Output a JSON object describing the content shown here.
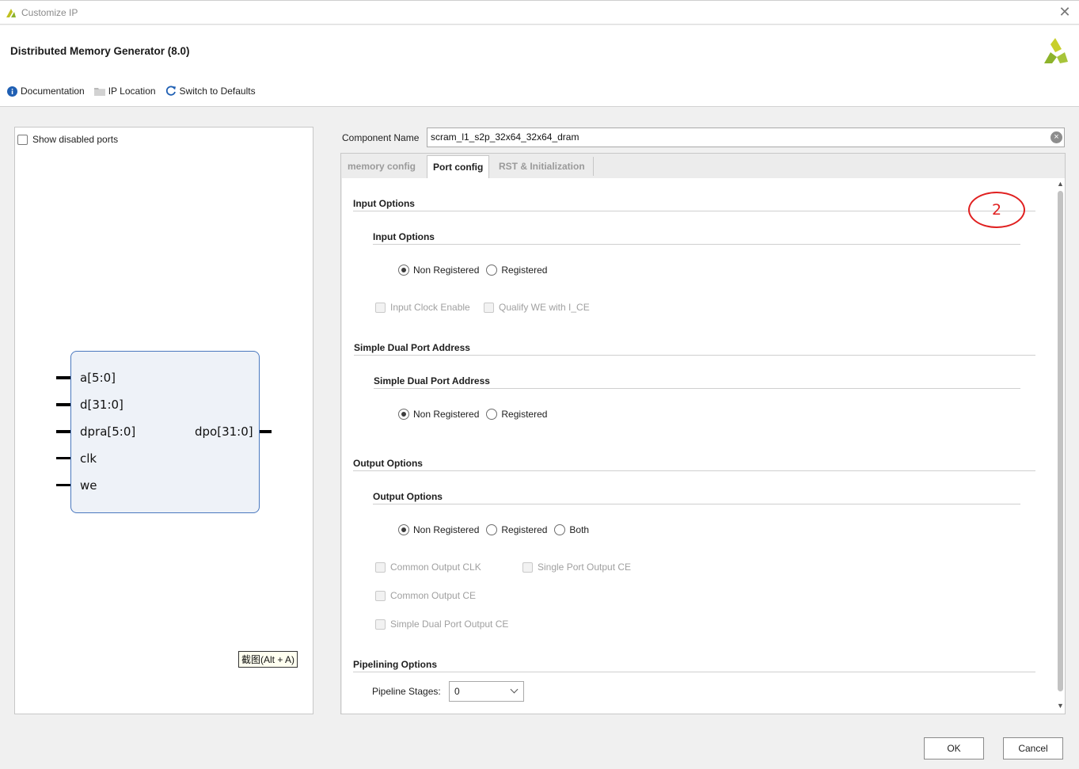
{
  "window": {
    "title": "Customize IP",
    "close_glyph": "✕"
  },
  "header": {
    "product_title": "Distributed Memory Generator (8.0)",
    "toolbar": {
      "documentation": "Documentation",
      "ip_location": "IP Location",
      "switch_defaults": "Switch to Defaults"
    }
  },
  "left_panel": {
    "show_disabled_ports": "Show disabled ports",
    "block": {
      "inputs": [
        "a[5:0]",
        "d[31:0]",
        "dpra[5:0]",
        "clk",
        "we"
      ],
      "output": "dpo[31:0]"
    },
    "tooltip": "截图(Alt + A)"
  },
  "component": {
    "label": "Component Name",
    "value": "scram_l1_s2p_32x64_32x64_dram",
    "clear_glyph": "×"
  },
  "tabs": [
    {
      "label": "memory config",
      "active": false
    },
    {
      "label": "Port config",
      "active": true
    },
    {
      "label": "RST & Initialization",
      "active": false
    }
  ],
  "port_config": {
    "input_options": {
      "title": "Input Options",
      "subtitle": "Input Options",
      "radios": [
        "Non Registered",
        "Registered"
      ],
      "selected": "Non Registered",
      "checkboxes": [
        "Input Clock Enable",
        "Qualify WE with I_CE"
      ]
    },
    "sdp_address": {
      "title": "Simple Dual Port Address",
      "subtitle": "Simple Dual Port Address",
      "radios": [
        "Non Registered",
        "Registered"
      ],
      "selected": "Non Registered"
    },
    "output_options": {
      "title": "Output Options",
      "subtitle": "Output Options",
      "radios": [
        "Non Registered",
        "Registered",
        "Both"
      ],
      "selected": "Non Registered",
      "checkboxes": [
        "Common Output CLK",
        "Single Port Output CE",
        "Common Output CE",
        "Simple Dual Port Output CE"
      ]
    },
    "pipelining": {
      "title": "Pipelining Options",
      "stages_label": "Pipeline Stages:",
      "stages_value": "0"
    }
  },
  "annotation": {
    "text": "2",
    "color": "#e02020"
  },
  "buttons": {
    "ok": "OK",
    "cancel": "Cancel"
  },
  "colors": {
    "accent_blue": "#1f5fb3",
    "block_border": "#4a78bf",
    "block_fill": "#eef2f8",
    "logo_green": "#8db32b"
  },
  "scrollbar": {
    "up_glyph": "▲",
    "down_glyph": "▼"
  }
}
